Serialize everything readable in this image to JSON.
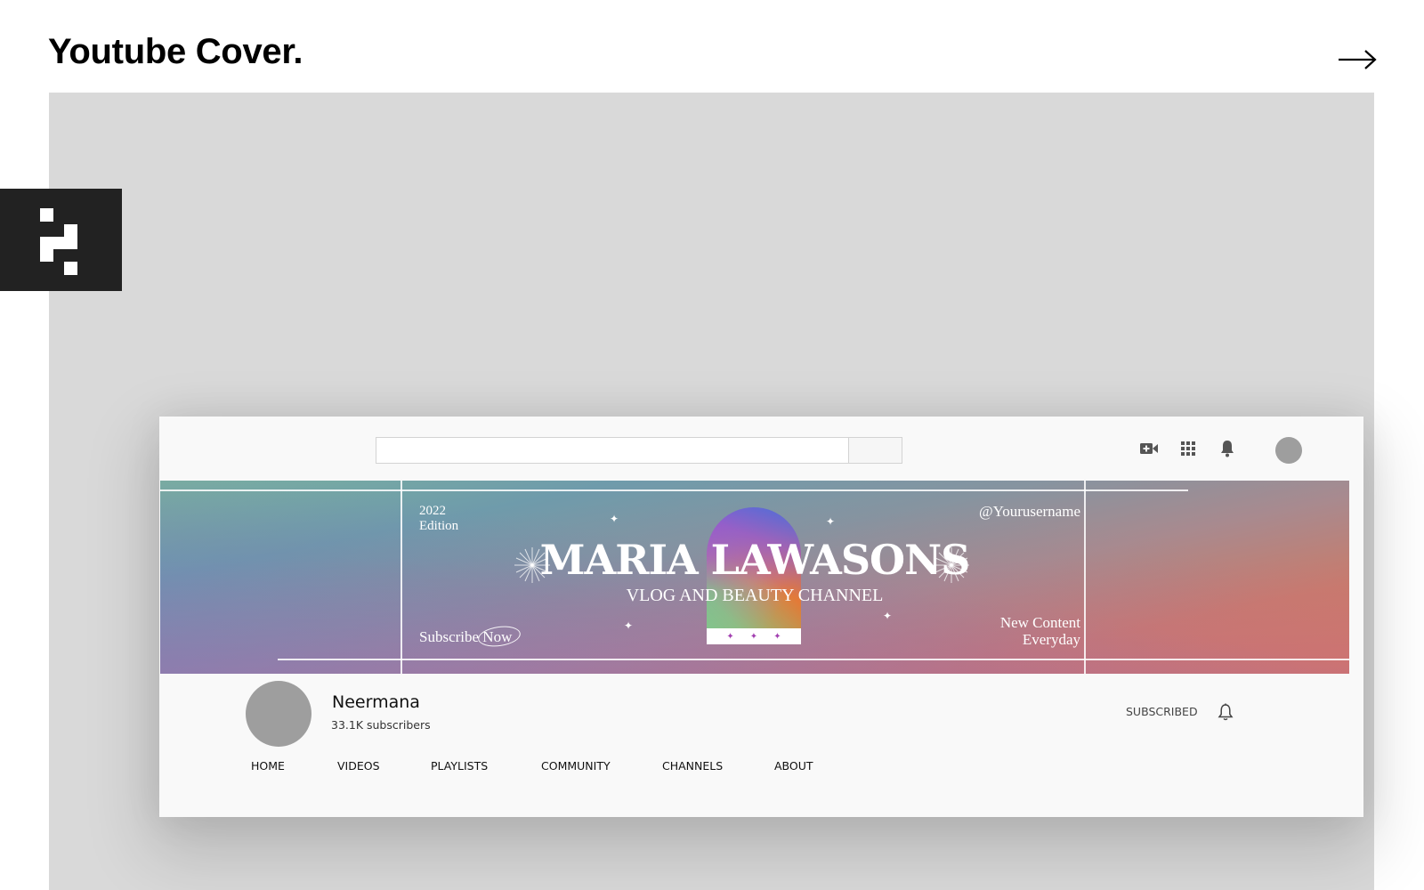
{
  "page": {
    "title": "Youtube Cover.",
    "next_icon": "arrow-right-icon"
  },
  "logo": {
    "icon": "pixel-logo-icon"
  },
  "youtube": {
    "search": {
      "value": "",
      "placeholder": "",
      "button_icon": "search-icon"
    },
    "header_icons": [
      {
        "name": "create-video-icon"
      },
      {
        "name": "apps-grid-icon"
      },
      {
        "name": "notifications-bell-icon"
      },
      {
        "name": "account-avatar"
      }
    ],
    "banner": {
      "edition_year": "2022",
      "edition_label": "Edition",
      "username": "@Yourusername",
      "title": "MARIA LAWASONS",
      "subtitle": "VLOG AND BEAUTY CHANNEL",
      "subscribe_text": "Subscribe Now",
      "new_content_line1": "New Content",
      "new_content_line2": "Everyday",
      "arch_stars": "+ + +",
      "colors": {
        "teal": "#79b0a0",
        "blue": "#6a8fc0",
        "coral": "#d47a5c",
        "pink": "#c46e95",
        "arch_purple": "#8a5fd0",
        "arch_orange": "#e07b35",
        "arch_green": "#7fd08e"
      }
    },
    "channel": {
      "name": "Neermana",
      "subscribers": "33.1K subscribers",
      "subscribe_status": "SUBSCRIBED",
      "bell_icon": "notification-bell-outline-icon"
    },
    "tabs": [
      {
        "label": "HOME"
      },
      {
        "label": "VIDEOS"
      },
      {
        "label": "PLAYLISTS"
      },
      {
        "label": "COMMUNITY"
      },
      {
        "label": "CHANNELS"
      },
      {
        "label": "ABOUT"
      }
    ]
  }
}
